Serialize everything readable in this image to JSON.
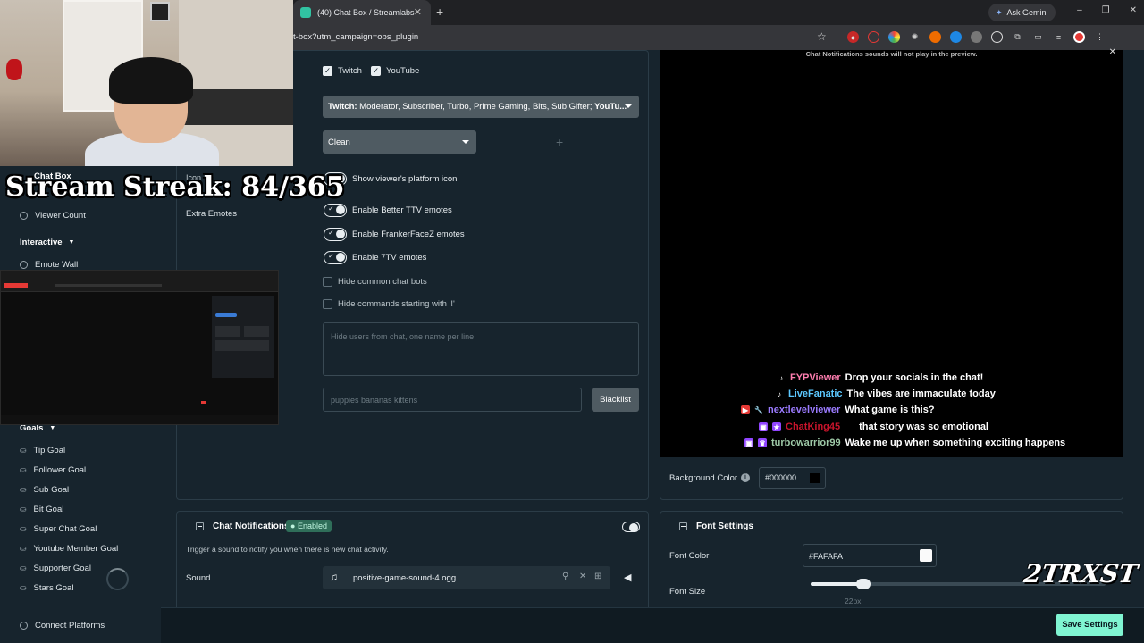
{
  "browser": {
    "tab_title": "(40) Chat Box / Streamlabs",
    "url": "t-box?utm_campaign=obs_plugin",
    "gemini_label": "Ask Gemini",
    "win_minimize": "–",
    "win_maximize": "❐",
    "win_close": "✕"
  },
  "overlay": {
    "stream_streak": "Stream Streak: 84/365",
    "watermark": "2TRXST"
  },
  "sidebar": {
    "chat_box": "Chat Box",
    "viewer_count": "Viewer Count",
    "interactive": "Interactive",
    "emote_wall": "Emote Wall",
    "goals": "Goals",
    "goal_items": [
      "Tip Goal",
      "Follower Goal",
      "Sub Goal",
      "Bit Goal",
      "Super Chat Goal",
      "Youtube Member Goal",
      "Supporter Goal",
      "Stars Goal"
    ],
    "connect": "Connect Platforms"
  },
  "settings": {
    "icon_label": "Icon",
    "extra_emotes": "Extra Emotes",
    "platforms": {
      "twitch": "Twitch",
      "youtube": "YouTube"
    },
    "badge_select_prefix": "Twitch:",
    "badge_select_value": " Moderator, Subscriber, Turbo, Prime Gaming, Bits, Sub Gifter; ",
    "badge_select_suffix": "YouTu...",
    "theme_select": "Clean",
    "toggles": [
      "Show viewer's platform icon",
      "Enable Better TTV emotes",
      "Enable FrankerFaceZ emotes",
      "Enable 7TV emotes"
    ],
    "checkboxes": [
      "Hide common chat bots",
      "Hide commands starting with '!'"
    ],
    "hide_users_placeholder": "Hide users from chat, one name per line",
    "blacklist_placeholder": "puppies bananas kittens",
    "blacklist_button": "Blacklist"
  },
  "preview": {
    "note": "Chat Notifications sounds will not play in the preview.",
    "close": "✕",
    "messages": [
      {
        "user": "FYPViewer",
        "text": "Drop your socials in the chat!",
        "color": "#ff7eb0"
      },
      {
        "user": "LiveFanatic",
        "text": "The vibes are immaculate today",
        "color": "#5cc8ff"
      },
      {
        "user": "nextlevelviewer",
        "text": "What game is this?",
        "color": "#9b7bff"
      },
      {
        "user": "ChatKing45",
        "text": "that story was so emotional",
        "color": "#c8142b"
      },
      {
        "user": "turbowarrior99",
        "text": "Wake me up when something exciting happens",
        "color": "#9ec9a7"
      }
    ],
    "bg_label": "Background Color",
    "bg_value": "#000000"
  },
  "chat_notifications": {
    "title": "Chat Notifications",
    "badge": "Enabled",
    "description": "Trigger a sound to notify you when there is new chat activity.",
    "sound_label": "Sound",
    "sound_file": "positive-game-sound-4.ogg"
  },
  "font_settings": {
    "title": "Font Settings",
    "color_label": "Font Color",
    "color_value": "#FAFAFA",
    "size_label": "Font Size",
    "size_value": "22px",
    "size_fraction": 0.18
  },
  "save_button": "Save Settings"
}
